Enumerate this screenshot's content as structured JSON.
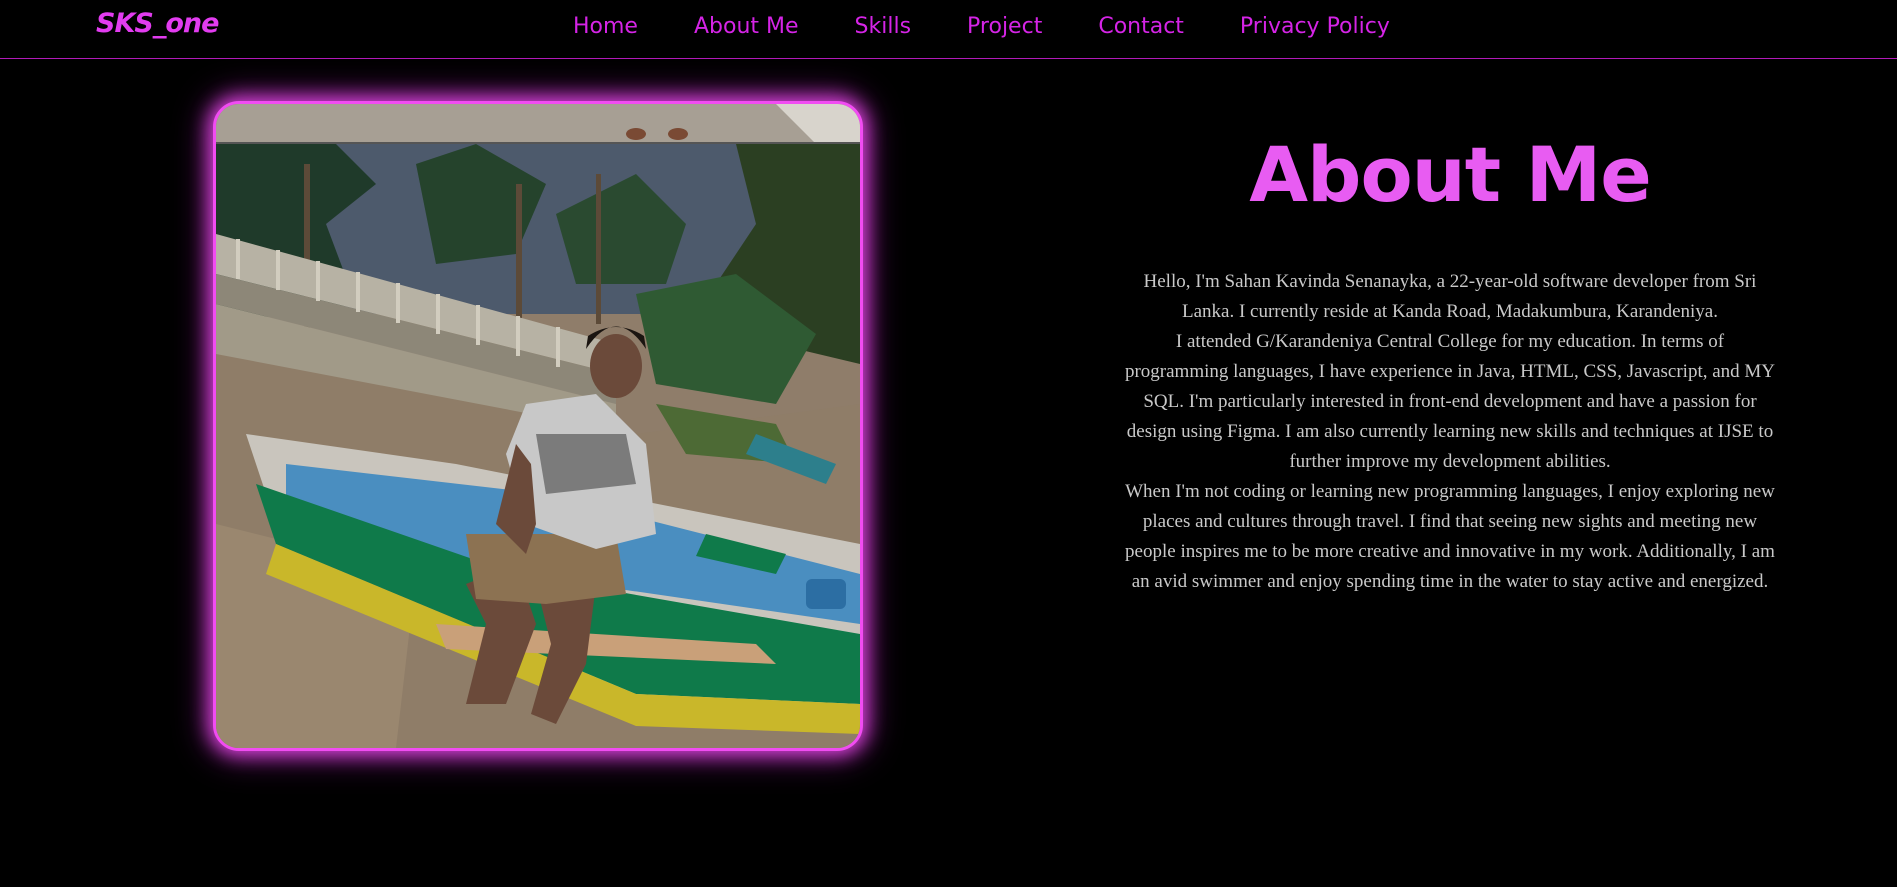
{
  "brand": {
    "logo_text": "SKS_one"
  },
  "nav": {
    "items": [
      {
        "label": "Home"
      },
      {
        "label": "About Me"
      },
      {
        "label": "Skills"
      },
      {
        "label": "Project"
      },
      {
        "label": "Contact"
      },
      {
        "label": "Privacy Policy"
      }
    ]
  },
  "about": {
    "title": "About Me",
    "paragraphs": [
      "Hello, I'm Sahan Kavinda Senanayka, a 22-year-old software developer from Sri Lanka. I currently reside at Kanda Road, Madakumbura, Karandeniya.",
      "I attended G/Karandeniya Central College for my education. In terms of programming languages, I have experience in Java, HTML, CSS, Javascript, and MY SQL. I'm particularly interested in front-end development and have a passion for design using Figma. I am also currently learning new skills and techniques at IJSE to further improve my development abilities.",
      "When I'm not coding or learning new programming languages, I enjoy exploring new places and cultures through travel. I find that seeing new sights and meeting new people inspires me to be more creative and innovative in my work. Additionally, I am an avid swimmer and enjoy spending time in the water to stay active and energized."
    ]
  },
  "colors": {
    "background": "#000000",
    "accent": "#d524e6",
    "title": "#e85cf2",
    "glow": "#f14cf2",
    "body_text": "#c9c9c9"
  }
}
